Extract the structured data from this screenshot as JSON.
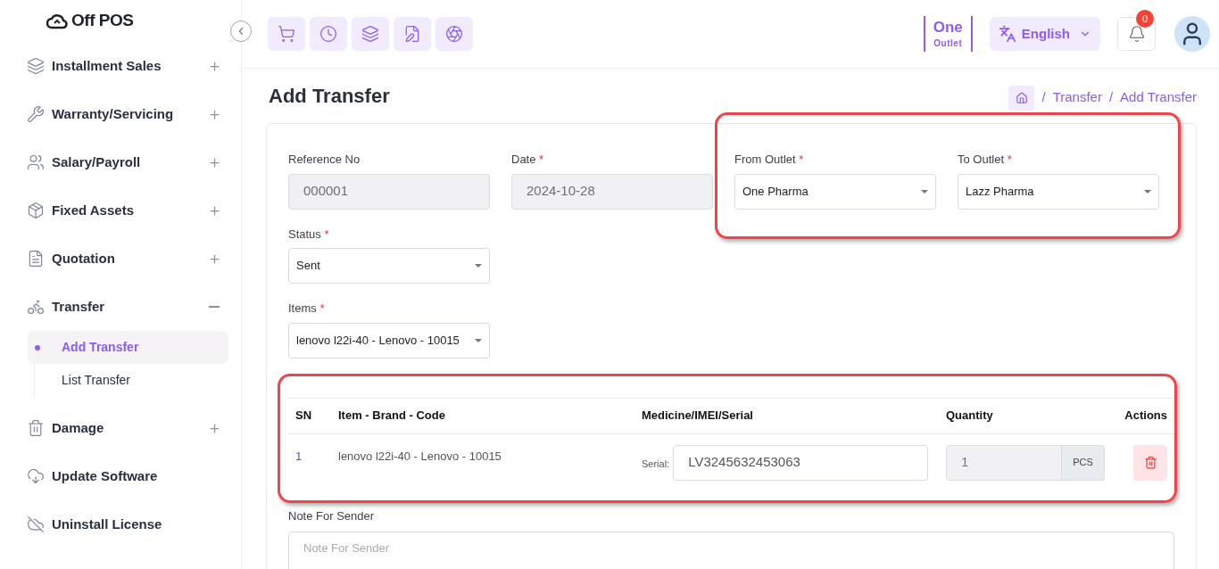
{
  "brand": {
    "name": "Off POS"
  },
  "sidebar": {
    "items": [
      {
        "label": "Installment Sales",
        "kind": "group",
        "expanded": false
      },
      {
        "label": "Warranty/Servicing",
        "kind": "group",
        "expanded": false
      },
      {
        "label": "Salary/Payroll",
        "kind": "group",
        "expanded": false
      },
      {
        "label": "Fixed Assets",
        "kind": "group",
        "expanded": false
      },
      {
        "label": "Quotation",
        "kind": "group",
        "expanded": false
      },
      {
        "label": "Transfer",
        "kind": "group",
        "expanded": true,
        "children": [
          {
            "label": "Add Transfer",
            "selected": true
          },
          {
            "label": "List Transfer",
            "selected": false
          }
        ]
      },
      {
        "label": "Damage",
        "kind": "group",
        "expanded": false
      },
      {
        "label": "Update Software",
        "kind": "link"
      },
      {
        "label": "Uninstall License",
        "kind": "link"
      }
    ]
  },
  "topbar": {
    "outlet": {
      "name": "One",
      "caption": "Outlet"
    },
    "language": "English",
    "notifications": "0"
  },
  "page": {
    "title": "Add Transfer",
    "breadcrumb": [
      {
        "separator": "/",
        "label": "Transfer"
      },
      {
        "separator": "/",
        "label": "Add Transfer"
      }
    ]
  },
  "form": {
    "rows": [
      [
        {
          "label": "Reference No",
          "kind": "input",
          "value": "000001",
          "disabled": true
        },
        {
          "label": "Date",
          "required_mark": "*",
          "kind": "input",
          "value": "2024-10-28",
          "disabled": true
        },
        {
          "label": "From Outlet",
          "required_mark": "*",
          "kind": "select",
          "value": "One Pharma",
          "disabled": false
        },
        {
          "label": "To Outlet",
          "required_mark": "*",
          "kind": "select",
          "value": "Lazz Pharma",
          "disabled": false
        }
      ],
      [
        {
          "label": "Status",
          "required_mark": "*",
          "kind": "select",
          "value": "Sent",
          "disabled": false
        }
      ],
      [
        {
          "label": "Items",
          "required_mark": "*",
          "kind": "select",
          "value": "lenovo l22i-40 - Lenovo - 10015",
          "disabled": false
        }
      ]
    ]
  },
  "table": {
    "columns": [
      "SN",
      "Item - Brand - Code",
      "Medicine/IMEI/Serial",
      "Quantity",
      "Actions"
    ],
    "rows": [
      {
        "sn": "1",
        "item": "lenovo l22i-40 - Lenovo - 10015",
        "serial_label": "Serial:",
        "serial": "LV3245632453063",
        "quantity": "1",
        "unit": "PCS"
      }
    ]
  },
  "note": {
    "label": "Note For Sender",
    "placeholder": "Note For Sender"
  }
}
